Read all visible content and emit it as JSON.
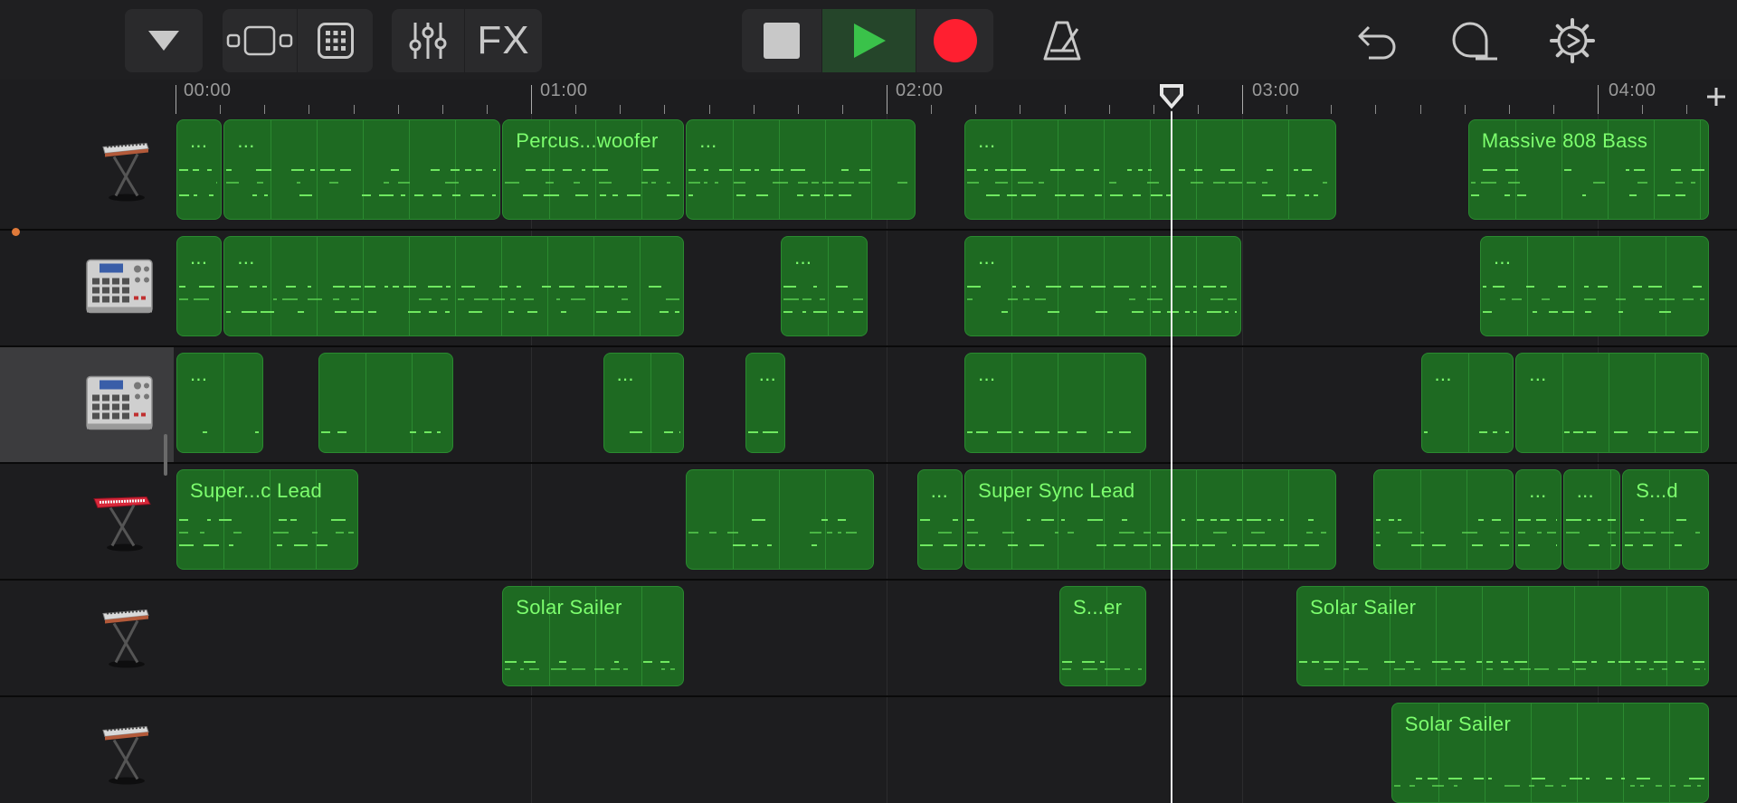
{
  "toolbar": {
    "fx_label": "FX",
    "colors": {
      "play": "#3ac24a",
      "record": "#ff1f30",
      "accent": "#3ac24a"
    },
    "icons": [
      "track-view-dropdown-icon",
      "browser-icon",
      "grid-view-icon",
      "mixer-icon",
      "fx-icon",
      "stop-icon",
      "play-icon",
      "record-icon",
      "metronome-icon",
      "undo-icon",
      "loop-icon",
      "settings-icon"
    ]
  },
  "ruler": {
    "markers": [
      "00:00",
      "01:00",
      "02:00",
      "03:00",
      "04:00"
    ],
    "playhead": "02:48"
  },
  "tracks": [
    {
      "id": "t1",
      "instrument_icon": "keyboard-stand-icon",
      "selected": false,
      "regions": [
        {
          "label": "...",
          "start": "00:00",
          "end": "00:08"
        },
        {
          "label": "...",
          "start": "00:08",
          "end": "00:55"
        },
        {
          "label": "Percus...woofer",
          "start": "00:55",
          "end": "01:26"
        },
        {
          "label": "...",
          "start": "01:26",
          "end": "02:05"
        },
        {
          "label": "...",
          "start": "02:13",
          "end": "03:16"
        },
        {
          "label": "Massive 808 Bass",
          "start": "03:38",
          "end": "04:19"
        }
      ]
    },
    {
      "id": "t2",
      "instrument_icon": "drum-machine-icon",
      "selected": false,
      "regions": [
        {
          "label": "...",
          "start": "00:00",
          "end": "00:08"
        },
        {
          "label": "...",
          "start": "00:08",
          "end": "01:26"
        },
        {
          "label": "...",
          "start": "01:42",
          "end": "01:57"
        },
        {
          "label": "...",
          "start": "02:13",
          "end": "03:00"
        },
        {
          "label": "...",
          "start": "03:40",
          "end": "04:19"
        }
      ]
    },
    {
      "id": "t3",
      "instrument_icon": "drum-machine-icon",
      "selected": true,
      "regions": [
        {
          "label": "...",
          "start": "00:00",
          "end": "00:15"
        },
        {
          "label": "",
          "start": "00:24",
          "end": "00:47"
        },
        {
          "label": "...",
          "start": "01:12",
          "end": "01:26"
        },
        {
          "label": "...",
          "start": "01:36",
          "end": "01:43"
        },
        {
          "label": "...",
          "start": "02:13",
          "end": "02:44"
        },
        {
          "label": "...",
          "start": "03:30",
          "end": "03:46"
        },
        {
          "label": "...",
          "start": "03:46",
          "end": "04:19"
        }
      ]
    },
    {
      "id": "t4",
      "instrument_icon": "red-synth-icon",
      "selected": false,
      "regions": [
        {
          "label": "Super...c Lead",
          "start": "00:00",
          "end": "00:31"
        },
        {
          "label": "",
          "start": "01:26",
          "end": "01:58"
        },
        {
          "label": "...",
          "start": "02:05",
          "end": "02:13"
        },
        {
          "label": "Super Sync Lead",
          "start": "02:13",
          "end": "03:16"
        },
        {
          "label": "",
          "start": "03:22",
          "end": "03:46"
        },
        {
          "label": "...",
          "start": "03:46",
          "end": "03:54"
        },
        {
          "label": "...",
          "start": "03:54",
          "end": "04:04"
        },
        {
          "label": "S...d",
          "start": "04:04",
          "end": "04:19"
        }
      ]
    },
    {
      "id": "t5",
      "instrument_icon": "keyboard-stand-icon",
      "selected": false,
      "regions": [
        {
          "label": "Solar Sailer",
          "start": "00:55",
          "end": "01:26"
        },
        {
          "label": "S...er",
          "start": "02:29",
          "end": "02:44"
        },
        {
          "label": "Solar Sailer",
          "start": "03:09",
          "end": "04:19"
        }
      ]
    },
    {
      "id": "t6",
      "instrument_icon": "keyboard-stand-icon",
      "selected": false,
      "regions": [
        {
          "label": "Solar Sailer",
          "start": "03:25",
          "end": "04:19"
        }
      ]
    }
  ]
}
